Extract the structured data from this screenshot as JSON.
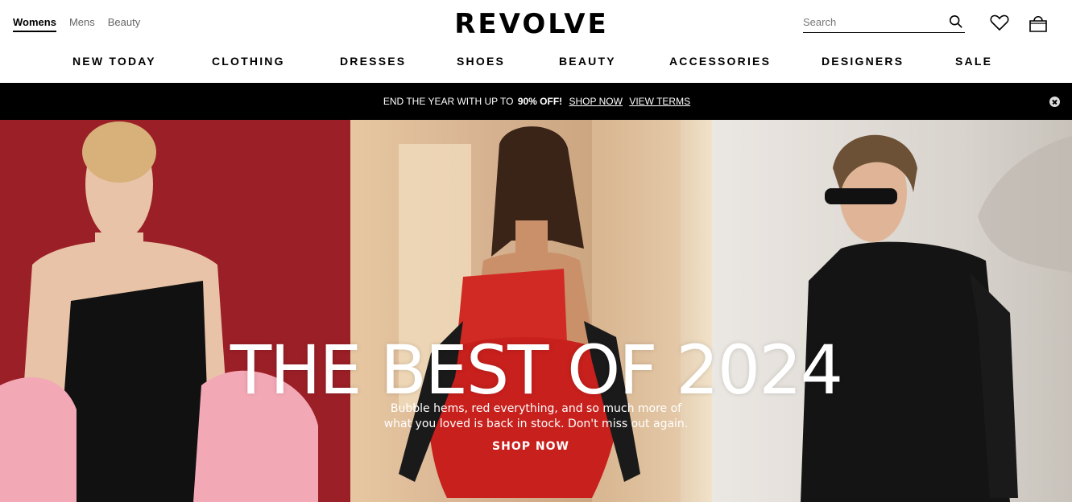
{
  "gender_nav": [
    {
      "label": "Womens",
      "active": true
    },
    {
      "label": "Mens",
      "active": false
    },
    {
      "label": "Beauty",
      "active": false
    }
  ],
  "brand": "REVOLVE",
  "search": {
    "placeholder": "Search",
    "icon": "search-icon"
  },
  "header_icons": [
    "heart-icon",
    "shopping-bag-icon"
  ],
  "main_nav": [
    "NEW TODAY",
    "CLOTHING",
    "DRESSES",
    "SHOES",
    "BEAUTY",
    "ACCESSORIES",
    "DESIGNERS",
    "SALE"
  ],
  "promo": {
    "text": "END THE YEAR WITH UP TO",
    "highlight": "90% OFF!",
    "shop_link": "SHOP NOW",
    "terms_link": "VIEW TERMS",
    "close_icon": "close-circle-icon"
  },
  "hero": {
    "title": "THE BEST OF 2024",
    "subtitle_line1": "Bubble hems, red everything, and so much more of",
    "subtitle_line2": "what you loved is back in stock. Don't miss out again.",
    "cta": "SHOP NOW"
  },
  "colors": {
    "promo_bg": "#000000",
    "panel_1": "#9b1f26",
    "panel_2": "#d6b190",
    "panel_3": "#ebe7e2"
  }
}
